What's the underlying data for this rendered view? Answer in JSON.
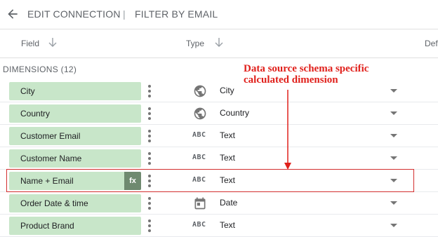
{
  "topbar": {
    "edit_connection": "EDIT CONNECTION",
    "separator": "|",
    "filter_by_email": "FILTER BY EMAIL"
  },
  "columns": {
    "field": "Field",
    "type": "Type",
    "default": "Def"
  },
  "section": {
    "label": "DIMENSIONS (12)"
  },
  "fields": [
    {
      "name": "City",
      "type": "City",
      "icon": "globe-icon"
    },
    {
      "name": "Country",
      "type": "Country",
      "icon": "globe-icon"
    },
    {
      "name": "Customer Email",
      "type": "Text",
      "icon": "abc-icon"
    },
    {
      "name": "Customer Name",
      "type": "Text",
      "icon": "abc-icon"
    },
    {
      "name": "Name + Email",
      "type": "Text",
      "icon": "abc-icon",
      "calculated_badge": "fx"
    },
    {
      "name": "Order Date & time",
      "type": "Date",
      "icon": "calendar-icon"
    },
    {
      "name": "Product Brand",
      "type": "Text",
      "icon": "abc-icon"
    }
  ],
  "abc_text": "ABC",
  "annotation": {
    "line1": "Data source schema specific",
    "line2": "calculated dimension"
  },
  "colors": {
    "chip": "#c8e6c9",
    "fx_badge": "#6f8a70",
    "annotation": "#e0201b"
  }
}
